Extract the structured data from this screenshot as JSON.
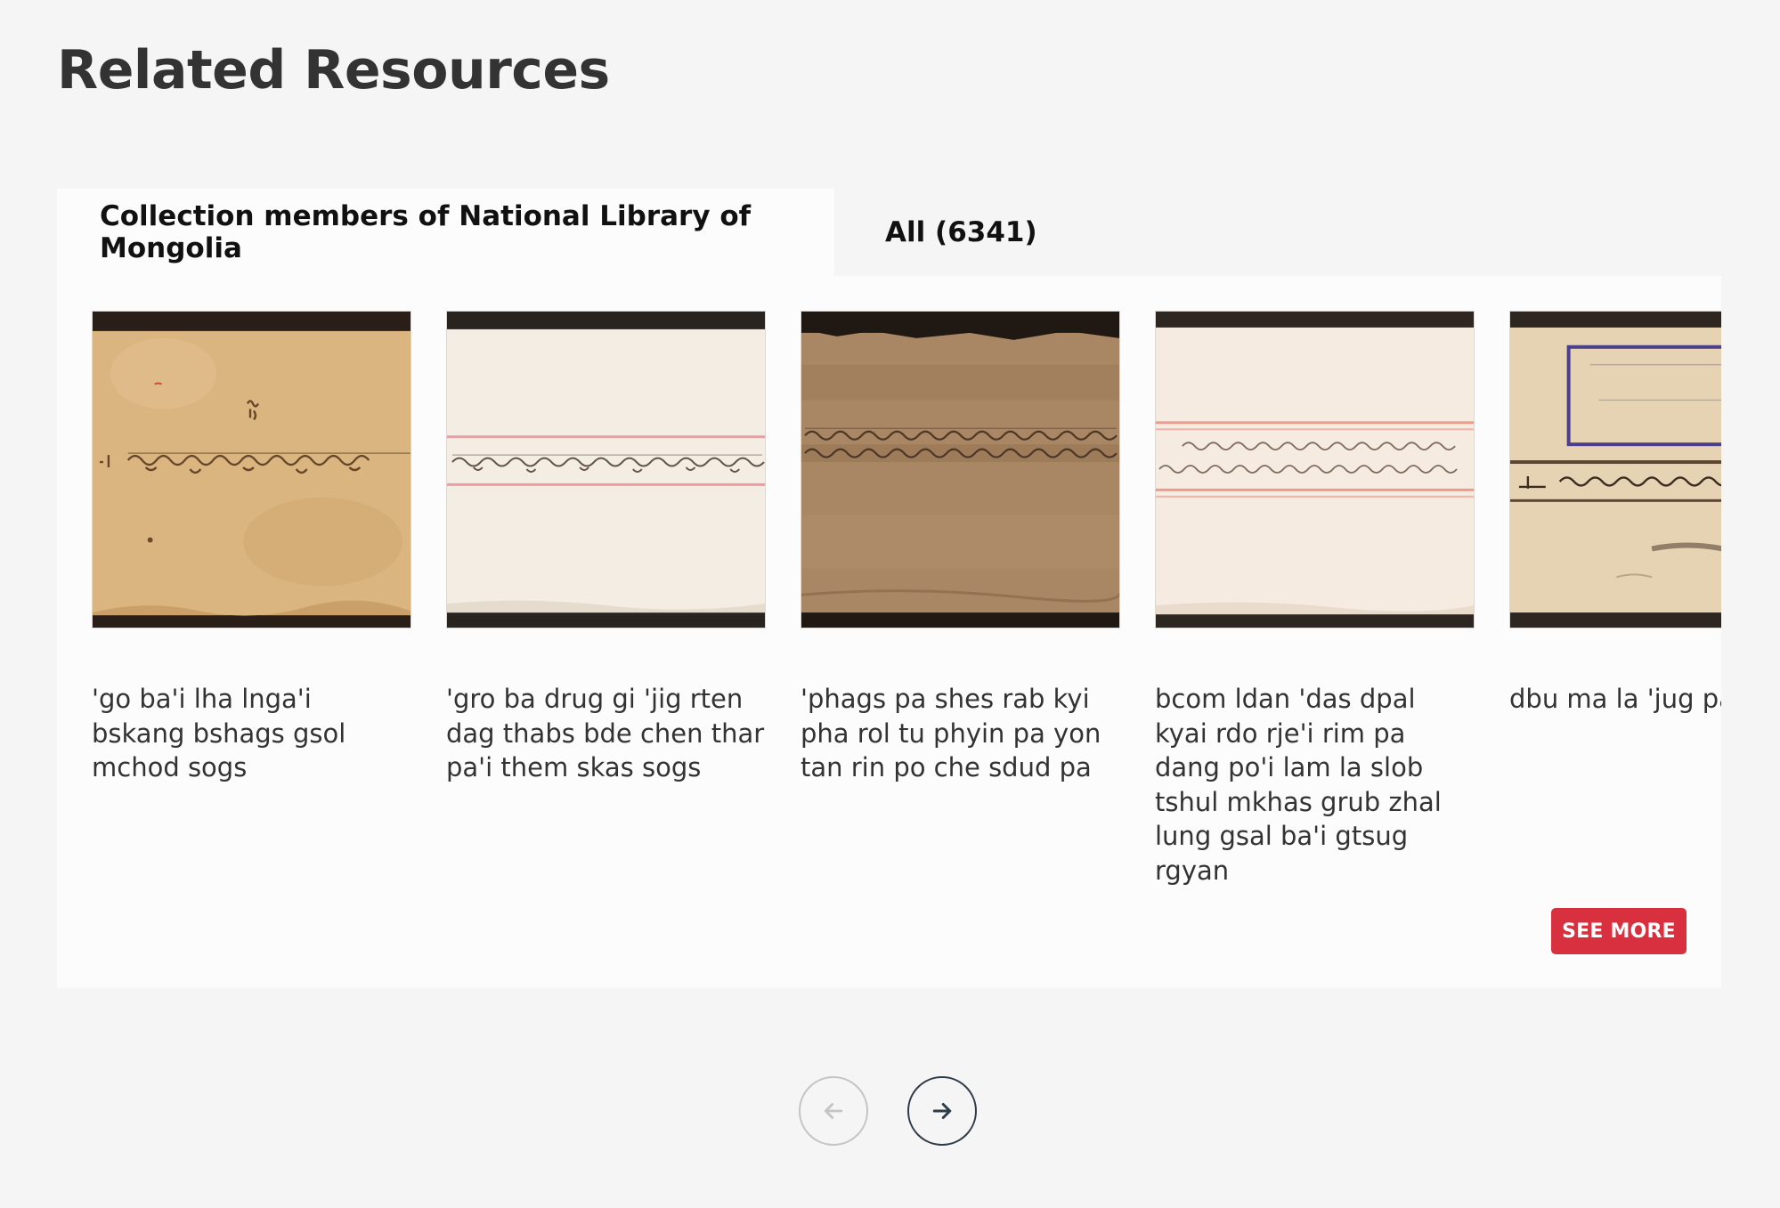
{
  "page": {
    "title": "Related Resources"
  },
  "tabs": [
    {
      "label": "Collection members of National Library of Mongolia",
      "active": true
    },
    {
      "label": "All (6341)",
      "active": false
    }
  ],
  "cards": [
    {
      "title": "'go ba'i lha lnga'i bskang bshags gsol mchod sogs"
    },
    {
      "title": "'gro ba drug gi 'jig rten dag thabs bde chen thar pa'i them skas sogs"
    },
    {
      "title": "'phags pa shes rab kyi pha rol tu phyin pa yon tan rin po che sdud pa"
    },
    {
      "title": "bcom ldan 'das dpal kyai rdo rje'i rim pa dang po'i lam la slob tshul mkhas grub zhal lung gsal ba'i gtsug rgyan"
    },
    {
      "title": "dbu ma la 'jug pa"
    }
  ],
  "actions": {
    "see_more": "SEE MORE"
  },
  "icons": {
    "prev": "arrow-left-icon",
    "next": "arrow-right-icon"
  },
  "colors": {
    "accent": "#d9303f",
    "nav_active": "#2e3b48",
    "nav_disabled": "#c4c4c4"
  }
}
